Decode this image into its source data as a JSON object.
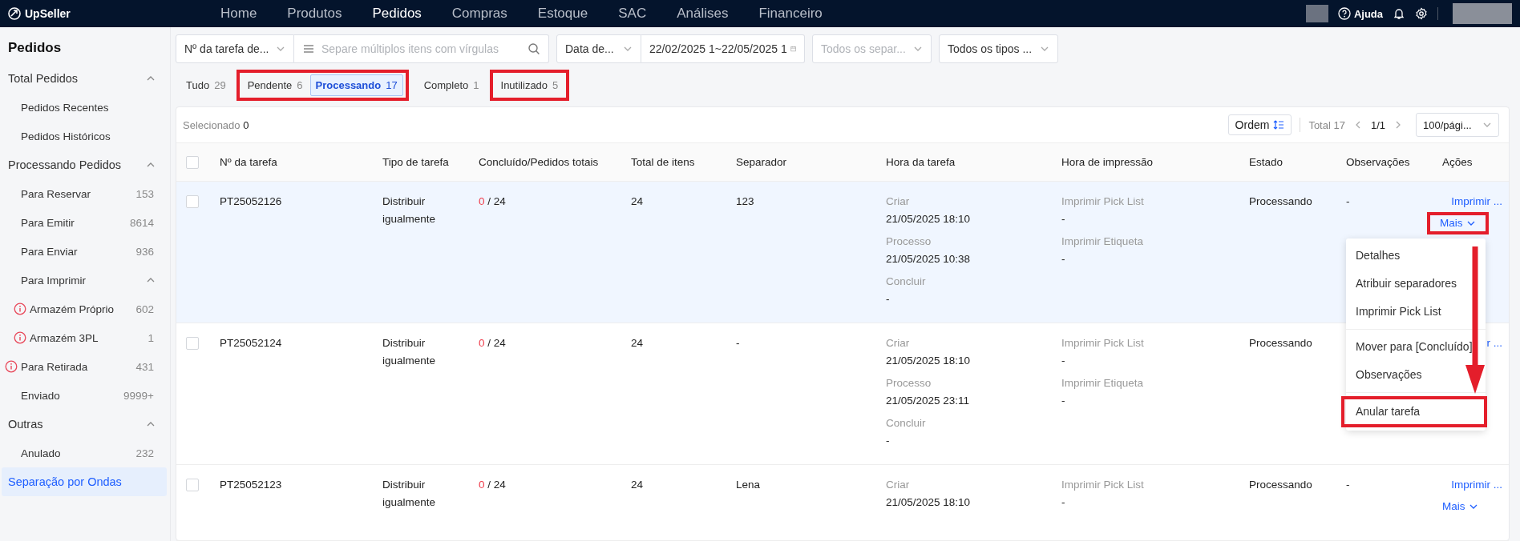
{
  "topbar": {
    "logo": "UpSeller",
    "nav": [
      {
        "label": "Home",
        "selected": false
      },
      {
        "label": "Produtos",
        "selected": false
      },
      {
        "label": "Pedidos",
        "selected": true
      },
      {
        "label": "Compras",
        "selected": false
      },
      {
        "label": "Estoque",
        "selected": false
      },
      {
        "label": "SAC",
        "selected": false
      },
      {
        "label": "Análises",
        "selected": false
      },
      {
        "label": "Financeiro",
        "selected": false
      }
    ],
    "help": "Ajuda"
  },
  "sidebar": {
    "title": "Pedidos",
    "items": [
      {
        "label": "Total Pedidos",
        "expanded": true,
        "selected": false,
        "children": [
          {
            "label": "Pedidos Recentes",
            "selected": false
          },
          {
            "label": "Pedidos Históricos",
            "selected": false
          }
        ]
      },
      {
        "label": "Processando Pedidos",
        "expanded": true,
        "selected": false,
        "children": [
          {
            "label": "Para Reservar",
            "count": "153",
            "selected": false
          },
          {
            "label": "Para Emitir",
            "count": "8614",
            "selected": false
          },
          {
            "label": "Para Enviar",
            "count": "936",
            "selected": false
          },
          {
            "label": "Para Imprimir",
            "expanded": true,
            "selected": false,
            "children": [
              {
                "label": "Armazém Próprio",
                "count": "602",
                "warning": true,
                "selected": false
              },
              {
                "label": "Armazém 3PL",
                "count": "1",
                "warning": true,
                "selected": false
              }
            ]
          },
          {
            "label": "Para Retirada",
            "count": "431",
            "warning": true,
            "selected": false
          },
          {
            "label": "Enviado",
            "count": "9999+",
            "selected": false
          }
        ]
      },
      {
        "label": "Outras",
        "expanded": true,
        "selected": false,
        "children": [
          {
            "label": "Anulado",
            "count": "232",
            "selected": false
          }
        ]
      },
      {
        "label": "Separação por Ondas",
        "selected": true
      }
    ]
  },
  "filters": {
    "search_type": "Nº da tarefa de...",
    "search": {
      "placeholder": "Separe múltiplos itens com vírgulas"
    },
    "date_type": "Data de...",
    "date_range": "22/02/2025 1~22/05/2025 1",
    "picker": {
      "placeholder": "Todos os separ..."
    },
    "task_type": "Todos os tipos ..."
  },
  "tabs": [
    {
      "label": "Tudo",
      "count": "29",
      "selected": false,
      "highlighted": false
    },
    {
      "label": "Pendente",
      "count": "6",
      "selected": false,
      "highlighted": true
    },
    {
      "label": "Processando",
      "count": "17",
      "selected": true,
      "highlighted": true
    },
    {
      "label": "Completo",
      "count": "1",
      "selected": false,
      "highlighted": false
    },
    {
      "label": "Inutilizado",
      "count": "5",
      "selected": false,
      "highlighted": true
    }
  ],
  "toolbar": {
    "selected_label": "Selecionado",
    "selected_count": "0",
    "sort": "Ordem",
    "total": "Total 17",
    "page": "1/1",
    "page_size": "100/pági..."
  },
  "table": {
    "columns": [
      "Nº da tarefa",
      "Tipo de tarefa",
      "Concluído/Pedidos totais",
      "Total de itens",
      "Separador",
      "Hora da tarefa",
      "Hora de impressão",
      "Estado",
      "Observações",
      "Ações"
    ],
    "rows": [
      {
        "selected": false,
        "hovered": true,
        "task_no": "PT25052126",
        "type": "Distribuir igualmente",
        "done": "0",
        "total": "/ 24",
        "items": "24",
        "picker": "123",
        "times": [
          {
            "label": "Criar",
            "value": "21/05/2025 18:10"
          },
          {
            "label": "Processo",
            "value": "21/05/2025 10:38"
          },
          {
            "label": "Concluir",
            "value": "-"
          }
        ],
        "prints": [
          {
            "label": "Imprimir Pick List",
            "value": "-"
          },
          {
            "label": "Imprimir Etiqueta",
            "value": "-"
          }
        ],
        "status": "Processando",
        "notes": "-",
        "action": "Imprimir ...",
        "more": {
          "label": "Mais",
          "highlighted": true,
          "menu": {
            "items": [
              {
                "label": "Detalhes",
                "divider_before": false,
                "highlighted": false
              },
              {
                "label": "Atribuir separadores",
                "divider_before": false,
                "highlighted": false
              },
              {
                "label": "Imprimir Pick List",
                "divider_before": false,
                "highlighted": false
              },
              {
                "label": "Mover para [Concluído]",
                "divider_before": true,
                "highlighted": false
              },
              {
                "label": "Observações",
                "divider_before": false,
                "highlighted": false
              },
              {
                "label": "Anular tarefa",
                "divider_before": true,
                "highlighted": true
              }
            ],
            "annotation_arrow": true
          }
        }
      },
      {
        "selected": false,
        "hovered": false,
        "task_no": "PT25052124",
        "type": "Distribuir igualmente",
        "done": "0",
        "total": "/ 24",
        "items": "24",
        "picker": "-",
        "times": [
          {
            "label": "Criar",
            "value": "21/05/2025 18:10"
          },
          {
            "label": "Processo",
            "value": "21/05/2025 23:11"
          },
          {
            "label": "Concluir",
            "value": "-"
          }
        ],
        "prints": [
          {
            "label": "Imprimir Pick List",
            "value": "-"
          },
          {
            "label": "Imprimir Etiqueta",
            "value": "-"
          }
        ],
        "status": "Processando",
        "action": "r ..."
      },
      {
        "selected": false,
        "hovered": false,
        "task_no": "PT25052123",
        "type": "Distribuir igualmente",
        "done": "0",
        "total": "/ 24",
        "items": "24",
        "picker": "Lena",
        "times": [
          {
            "label": "Criar",
            "value": "21/05/2025 18:10"
          }
        ],
        "prints": [
          {
            "label": "Imprimir Pick List",
            "value": "-"
          }
        ],
        "status": "Processando",
        "notes": "-",
        "action": "Imprimir ...",
        "more": {
          "label": "Mais",
          "highlighted": false
        }
      }
    ],
    "select_all": {
      "checked": false
    }
  }
}
